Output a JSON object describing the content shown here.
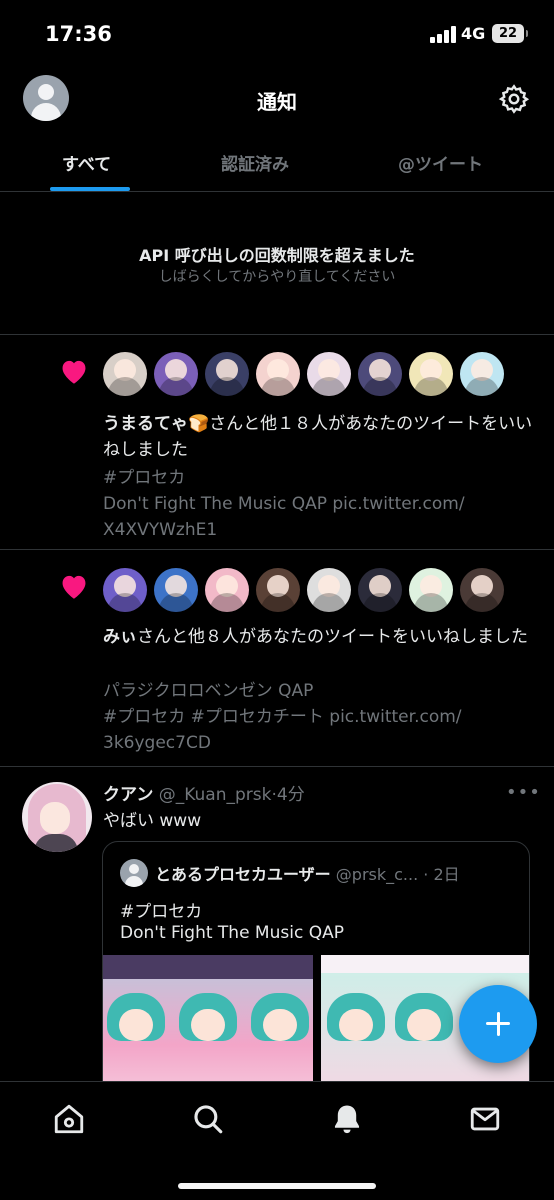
{
  "status_bar": {
    "time": "17:36",
    "network": "4G",
    "battery": "22"
  },
  "header": {
    "title": "通知"
  },
  "tabs": [
    {
      "label": "すべて",
      "active": true
    },
    {
      "label": "認証済み",
      "active": false
    },
    {
      "label": "@ツイート",
      "active": false
    }
  ],
  "notice": {
    "title": "API 呼び出しの回数制限を超えました",
    "subtitle": "しばらくしてからやり直してください"
  },
  "notifications": [
    {
      "type": "like",
      "name": "うまるてゃ🍞",
      "text": "さんと他１８人があなたのツイートをいいねしました",
      "tweet_lines": [
        "#プロセカ",
        "Don't Fight The Music QAP pic.twitter.com/",
        "X4XVYWzhE1"
      ],
      "avatar_colors": [
        "#d8cfc8",
        "#7b5fb8",
        "#3a3f66",
        "#f4d3cf",
        "#e9dbe8",
        "#4d4a7a",
        "#f1e7b8",
        "#bfe6f2"
      ]
    },
    {
      "type": "like",
      "name": "みぃ",
      "text": "さんと他８人があなたのツイートをいいねしました",
      "tweet_lines": [
        "パラジクロロベンゼン QAP",
        "#プロセカ #プロセカチート pic.twitter.com/",
        "3k6ygec7CD"
      ],
      "avatar_colors": [
        "#6f5fc9",
        "#3d73c8",
        "#f2b9c8",
        "#5a4136",
        "#dedede",
        "#2b2b3a",
        "#dff2e0",
        "#4a3a36"
      ]
    }
  ],
  "tweet": {
    "name": "クアン",
    "handle": "@_Kuan_prsk",
    "time": "4分",
    "more": "•••",
    "text": "やばい www",
    "quote": {
      "name": "とあるプロセカユーザー",
      "handle": "@prsk_c...",
      "time": "2日",
      "tag": "#プロセカ",
      "text": "Don't Fight The Music QAP"
    }
  },
  "colors": {
    "accent": "#1d9bf0",
    "like": "#f91880",
    "background": "#000000"
  },
  "icons": {
    "settings": "gear-icon",
    "like": "heart-icon",
    "compose": "plus-icon",
    "nav": [
      "home-icon",
      "search-icon",
      "bell-icon",
      "mail-icon"
    ]
  }
}
